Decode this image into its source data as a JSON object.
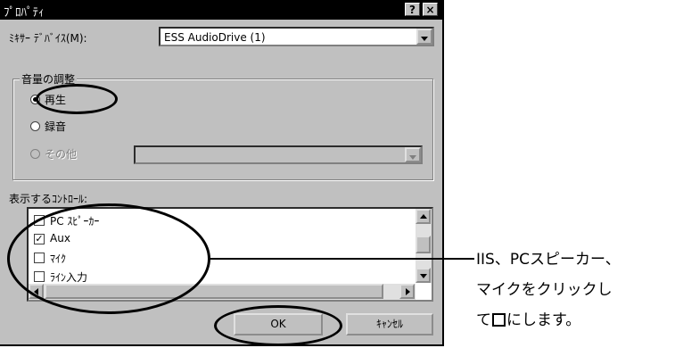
{
  "window": {
    "title": "ﾌﾟﾛﾊﾟﾃｨ",
    "help_button": "?",
    "close_button": "×"
  },
  "mixer": {
    "label": "ﾐｷｻｰ ﾃﾞﾊﾞｲｽ(M):",
    "value": "ESS AudioDrive (1)"
  },
  "volume_group": {
    "title": "音量の調整",
    "options": [
      {
        "label": "再生",
        "selected": true,
        "enabled": true
      },
      {
        "label": "録音",
        "selected": false,
        "enabled": true
      },
      {
        "label": "その他",
        "selected": false,
        "enabled": false
      }
    ]
  },
  "controls": {
    "label": "表示するｺﾝﾄﾛｰﾙ:",
    "items": [
      {
        "label": "PC ｽﾋﾟｰｶｰ",
        "checked": false
      },
      {
        "label": "Aux",
        "checked": true
      },
      {
        "label": "ﾏｲｸ",
        "checked": false
      },
      {
        "label": "ﾗｲﾝ入力",
        "checked": false
      }
    ]
  },
  "buttons": {
    "ok": "OK",
    "cancel": "ｷｬﾝｾﾙ"
  },
  "callout": {
    "line1": "IIS、PCスピーカー、",
    "line2": "マイクをクリックし",
    "line3_before": "て",
    "line3_after": "にします。"
  }
}
